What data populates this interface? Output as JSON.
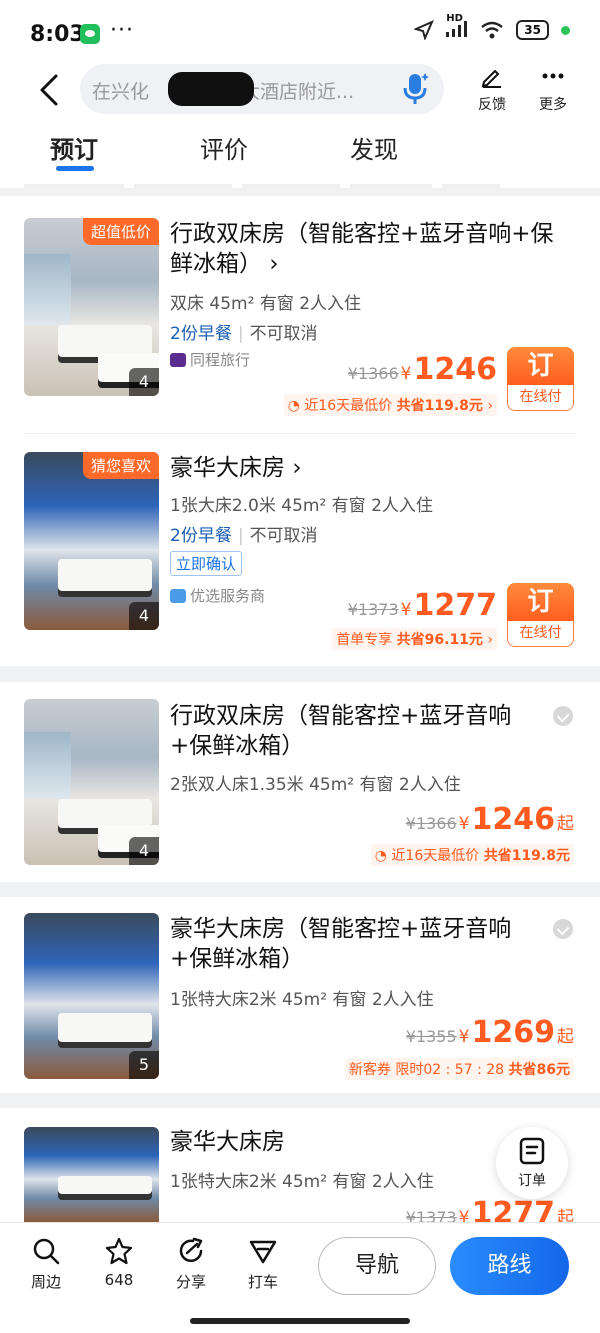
{
  "status_bar": {
    "time": "8:03",
    "more_dots": "···",
    "network": "HD",
    "battery": "35"
  },
  "header": {
    "search_prefix": "在兴化",
    "search_suffix": "大酒店附近...",
    "feedback": "反馈",
    "more": "更多"
  },
  "tabs": [
    {
      "label": "预订"
    },
    {
      "label": "评价"
    },
    {
      "label": "发现"
    }
  ],
  "rooms": [
    {
      "badge": "超值低价",
      "image_count": "4",
      "title_line1": "行政双床房（智能客控+蓝牙音响+保",
      "title_line2": "鲜冰箱）",
      "spec": "双床  45m²  有窗  2人入住",
      "breakfast": "2份早餐",
      "cancel": "不可取消",
      "vendor": "同程旅行",
      "old_price": "¥1366",
      "currency": "¥",
      "price": "1246",
      "promo_a": "近16天最低价",
      "promo_b": "共省119.8元",
      "book_top": "订",
      "book_bottom": "在线付"
    },
    {
      "badge": "猜您喜欢",
      "image_count": "4",
      "title_line1": "豪华大床房",
      "spec": "1张大床2.0米  45m²  有窗  2人入住",
      "breakfast": "2份早餐",
      "cancel": "不可取消",
      "confirm": "立即确认",
      "vendor": "优选服务商",
      "old_price": "¥1373",
      "currency": "¥",
      "price": "1277",
      "promo_a": "首单专享",
      "promo_b": "共省96.11元",
      "book_top": "订",
      "book_bottom": "在线付"
    },
    {
      "image_count": "4",
      "title_line1": "行政双床房（智能客控+蓝牙音响",
      "title_line2": "+保鲜冰箱）",
      "spec": "2张双人床1.35米  45m²  有窗  2人入住",
      "old_price": "¥1366",
      "currency": "¥",
      "price": "1246",
      "qi": "起",
      "promo_a": "近16天最低价",
      "promo_b": "共省119.8元"
    },
    {
      "image_count": "5",
      "title_line1": "豪华大床房（智能客控+蓝牙音响",
      "title_line2": "+保鲜冰箱）",
      "spec": "1张特大床2米  45m²  有窗  2人入住",
      "old_price": "¥1355",
      "currency": "¥",
      "price": "1269",
      "qi": "起",
      "promo_a": "新客券",
      "promo_timer": "限时02 : 57 : 28",
      "promo_b": "共省86元"
    },
    {
      "title_line1": "豪华大床房",
      "spec": "1张特大床2米  45m²  有窗  2人入住",
      "old_price": "¥1373",
      "currency": "¥",
      "price": "1277",
      "qi": "起"
    }
  ],
  "order_fab": "订单",
  "bottom_bar": {
    "nearby": "周边",
    "favorites": "648",
    "share": "分享",
    "taxi": "打车",
    "navigate": "导航",
    "route": "路线"
  },
  "colors": {
    "accent_orange": "#ff5a1f",
    "accent_blue": "#1a73e8"
  }
}
